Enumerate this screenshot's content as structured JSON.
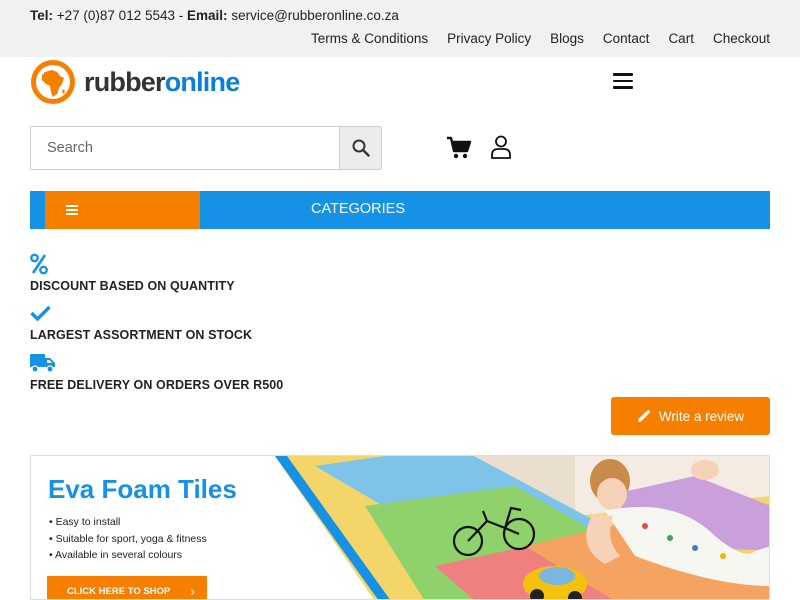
{
  "topbar": {
    "tel_label": "Tel:",
    "tel_value": "+27 (0)87 012 5543",
    "separator": "-",
    "email_label": "Email:",
    "email_value": "service@rubberonline.co.za",
    "links": [
      "Terms & Conditions",
      "Privacy Policy",
      "Blogs",
      "Contact",
      "Cart",
      "Checkout"
    ]
  },
  "logo": {
    "text_dark": "rubber",
    "text_blue": "online"
  },
  "search": {
    "placeholder": "Search"
  },
  "nav": {
    "categories_label": "CATEGORIES"
  },
  "features": [
    {
      "icon": "percent-icon",
      "text": "DISCOUNT BASED ON QUANTITY"
    },
    {
      "icon": "check-icon",
      "text": "LARGEST ASSORTMENT ON STOCK"
    },
    {
      "icon": "truck-icon",
      "text": "FREE DELIVERY ON ORDERS OVER R500"
    }
  ],
  "review_button": {
    "label": "Write a review"
  },
  "banner": {
    "title": "Eva Foam Tiles",
    "bullets": [
      "Easy to install",
      "Suitable for sport, yoga & fitness",
      "Available in several colours"
    ],
    "cta": "CLICK HERE TO SHOP"
  },
  "colors": {
    "orange": "#f77f00",
    "blue": "#1592e6",
    "topbar_bg": "#f1f1f1"
  }
}
